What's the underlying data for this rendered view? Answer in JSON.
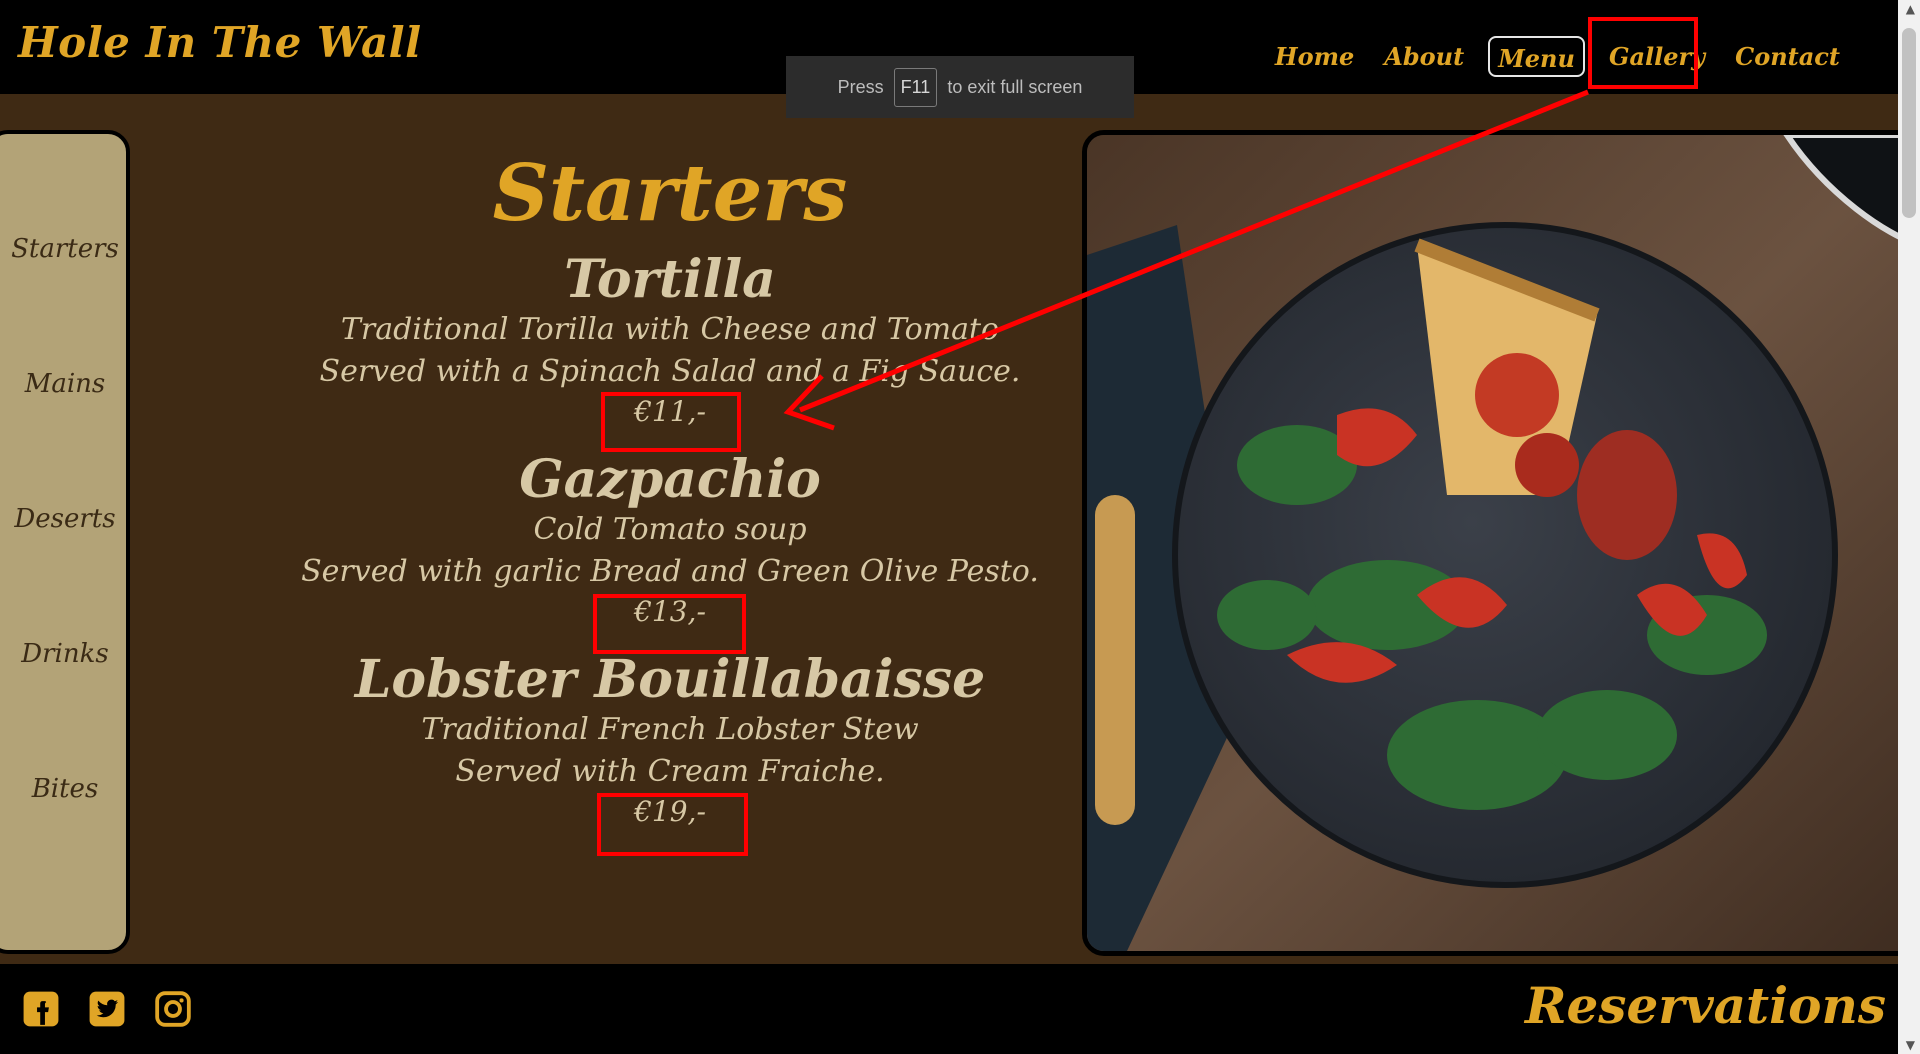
{
  "header": {
    "brand": "Hole In The Wall"
  },
  "nav": [
    {
      "label": "Home"
    },
    {
      "label": "About"
    },
    {
      "label": "Menu"
    },
    {
      "label": "Gallery"
    },
    {
      "label": "Contact"
    }
  ],
  "fullscreen_toast": {
    "prefix": "Press",
    "key": "F11",
    "suffix": "to exit full screen"
  },
  "sidebar": {
    "items": [
      {
        "label": "Starters"
      },
      {
        "label": "Mains"
      },
      {
        "label": "Deserts"
      },
      {
        "label": "Drinks"
      },
      {
        "label": "Bites"
      }
    ]
  },
  "menu": {
    "title": "Starters",
    "dishes": [
      {
        "name": "Tortilla",
        "desc1": "Traditional Torilla with Cheese and Tomato",
        "desc2": "Served with a Spinach Salad and a Fig Sauce.",
        "price": "€11,-"
      },
      {
        "name": "Gazpachio",
        "desc1": "Cold Tomato soup",
        "desc2": "Served with garlic Bread and Green Olive Pesto.",
        "price": "€13,-"
      },
      {
        "name": "Lobster Bouillabaisse",
        "desc1": "Traditional French Lobster Stew",
        "desc2": "Served with Cream Fraiche.",
        "price": "€19,-"
      }
    ]
  },
  "footer": {
    "icons": [
      "facebook-icon",
      "twitter-icon",
      "instagram-icon"
    ],
    "reservations": "Reservations"
  },
  "colors": {
    "accent": "#e0a526",
    "page_bg": "#3f2a14",
    "sidebar_bg": "#b3a377",
    "text": "#d7c8a5",
    "annotation": "#ff0000"
  }
}
